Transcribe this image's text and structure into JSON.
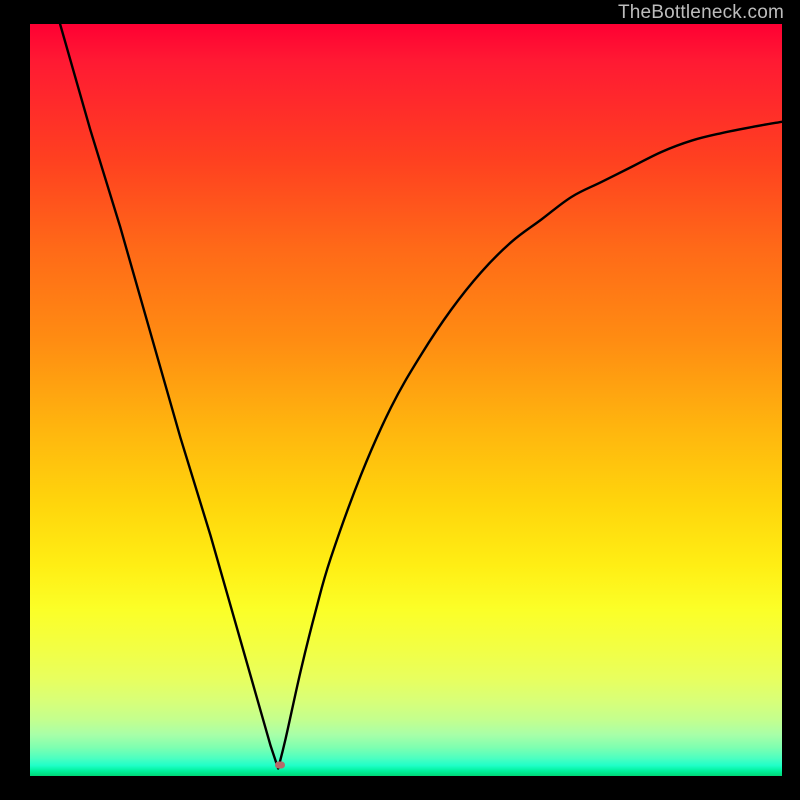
{
  "watermark": "TheBottleneck.com",
  "colors": {
    "frame": "#000000",
    "curve": "#000000",
    "marker": "#b66a6a"
  },
  "chart_data": {
    "type": "line",
    "title": "",
    "xlabel": "",
    "ylabel": "",
    "xlim": [
      0,
      100
    ],
    "ylim": [
      0,
      100
    ],
    "grid": false,
    "background": "vertical-gradient red→yellow→green (bottleneck heatmap)",
    "optimum_x": 33,
    "marker": {
      "x": 33.3,
      "y": 1.5
    },
    "description": "V-shaped bottleneck curve. Value drops steeply and nearly linearly from top-left to a minimum near x≈33, then rises with diminishing slope (concave) toward the upper right.",
    "series": [
      {
        "name": "bottleneck-curve",
        "x": [
          4,
          8,
          12,
          16,
          20,
          24,
          28,
          30,
          32,
          33,
          34,
          36,
          38,
          40,
          44,
          48,
          52,
          56,
          60,
          64,
          68,
          72,
          76,
          80,
          84,
          88,
          92,
          96,
          100
        ],
        "y": [
          100,
          86,
          73,
          59,
          45,
          32,
          18,
          11,
          4,
          1,
          5,
          14,
          22,
          29,
          40,
          49,
          56,
          62,
          67,
          71,
          74,
          77,
          79,
          81,
          83,
          84.5,
          85.5,
          86.3,
          87
        ]
      }
    ]
  }
}
